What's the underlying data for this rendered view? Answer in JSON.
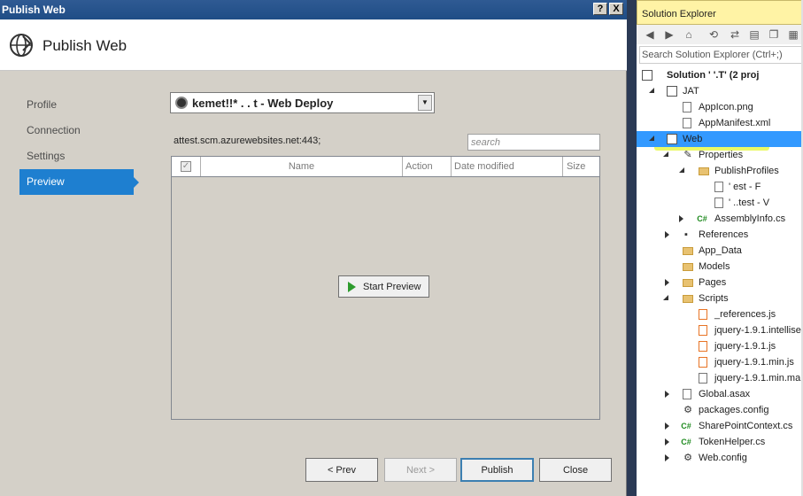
{
  "dialog": {
    "title": "Publish Web",
    "header_title": "Publish Web",
    "title_buttons": {
      "help": "?",
      "close": "X"
    },
    "nav": [
      {
        "label": "Profile",
        "active": false
      },
      {
        "label": "Connection",
        "active": false
      },
      {
        "label": "Settings",
        "active": false
      },
      {
        "label": "Preview",
        "active": true
      }
    ],
    "profile_selected": "kemet!!*    . . t - Web Deploy",
    "server": "           attest.scm.azurewebsites.net:443; ",
    "search_placeholder": "search",
    "grid_columns": [
      "Name",
      "Action",
      "Date modified",
      "Size"
    ],
    "start_preview": "Start Preview",
    "buttons": {
      "prev": "< Prev",
      "next": "Next >",
      "publish": "Publish",
      "close": "Close"
    }
  },
  "solution_explorer": {
    "title": "Solution Explorer",
    "search_placeholder": "Search Solution Explorer (Ctrl+;)",
    "items": [
      {
        "label": "Solution '            '.T' (2 proj",
        "icon": "solution-icon"
      },
      {
        "label": "          JAT",
        "icon": "project-icon"
      },
      {
        "label": "AppIcon.png",
        "icon": "image-icon"
      },
      {
        "label": "AppManifest.xml",
        "icon": "xml-icon"
      },
      {
        "label": "              Web",
        "icon": "web-project-icon"
      },
      {
        "label": "Properties",
        "icon": "wrench-icon"
      },
      {
        "label": "PublishProfiles",
        "icon": "folder-icon"
      },
      {
        "label": "'           est - F",
        "icon": "file-icon"
      },
      {
        "label": "'         ..test - V",
        "icon": "file-icon"
      },
      {
        "label": "AssemblyInfo.cs",
        "icon": "csharp-icon"
      },
      {
        "label": "References",
        "icon": "references-icon"
      },
      {
        "label": "App_Data",
        "icon": "folder-icon"
      },
      {
        "label": "Models",
        "icon": "folder-icon"
      },
      {
        "label": "Pages",
        "icon": "folder-icon"
      },
      {
        "label": "Scripts",
        "icon": "folder-icon"
      },
      {
        "label": "_references.js",
        "icon": "js-icon"
      },
      {
        "label": "jquery-1.9.1.intellise",
        "icon": "js-icon"
      },
      {
        "label": "jquery-1.9.1.js",
        "icon": "js-icon"
      },
      {
        "label": "jquery-1.9.1.min.js",
        "icon": "js-icon"
      },
      {
        "label": "jquery-1.9.1.min.ma",
        "icon": "file-icon"
      },
      {
        "label": "Global.asax",
        "icon": "file-icon"
      },
      {
        "label": "packages.config",
        "icon": "config-icon"
      },
      {
        "label": "SharePointContext.cs",
        "icon": "csharp-icon"
      },
      {
        "label": "TokenHelper.cs",
        "icon": "csharp-icon"
      },
      {
        "label": "Web.config",
        "icon": "config-icon"
      }
    ]
  }
}
